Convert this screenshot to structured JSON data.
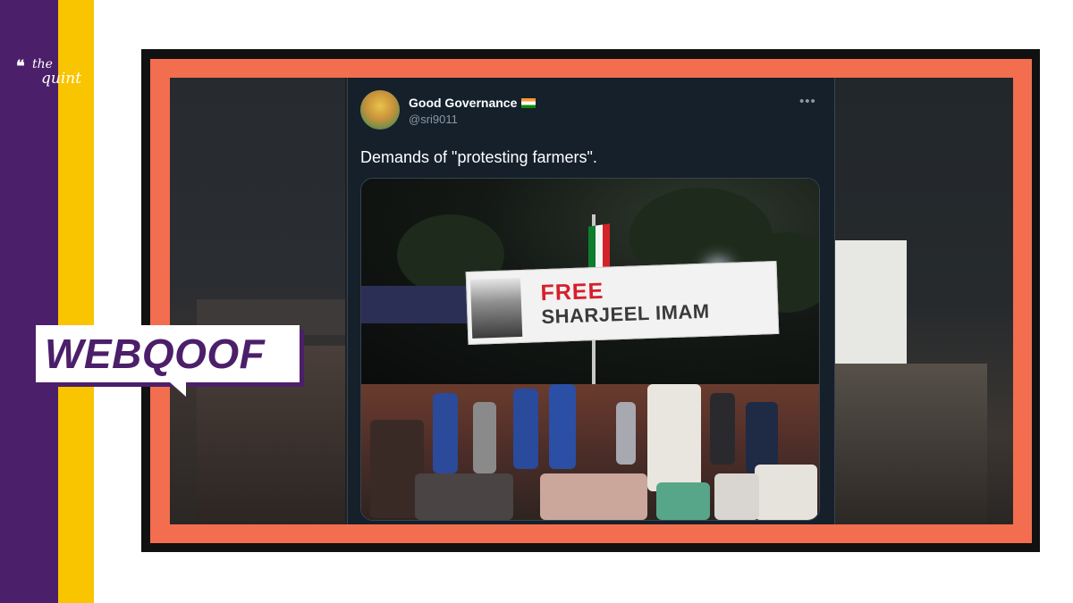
{
  "brand": {
    "logo_line1": "the",
    "logo_line2": "quint"
  },
  "tag": "WEBQOOF",
  "tweet": {
    "display_name": "Good Governance",
    "handle": "@sri9011",
    "more_glyph": "•••",
    "text": "Demands of \"protesting farmers\"."
  },
  "photo": {
    "banner_line1": "FREE",
    "banner_line2": "SHARJEEL IMAM"
  },
  "colors": {
    "purple": "#4b1f6a",
    "yellow": "#f9c400",
    "orange": "#f26e4f",
    "tweet_bg": "#15202b"
  }
}
